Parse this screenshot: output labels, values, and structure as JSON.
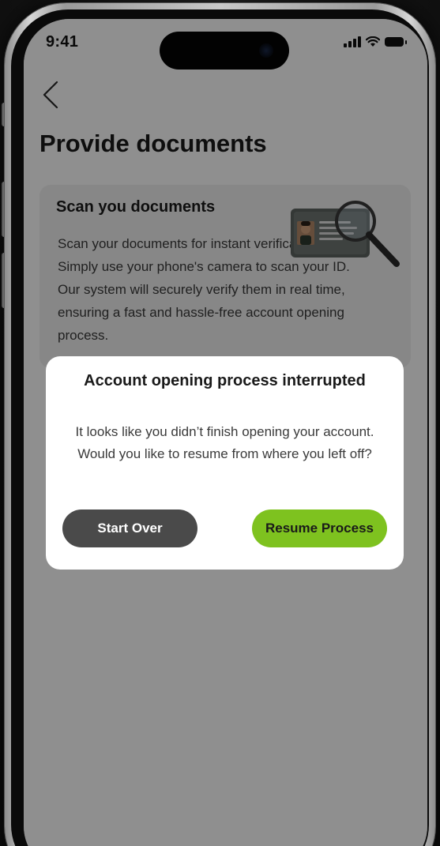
{
  "status_bar": {
    "time": "9:41"
  },
  "page": {
    "title": "Provide documents"
  },
  "doc_card": {
    "title": "Scan you documents",
    "body": "Scan your documents for instant verification. Simply use your phone's camera to scan your ID. Our system will securely verify them in real time, ensuring a fast and hassle-free account opening process."
  },
  "modal": {
    "title": "Account opening process interrupted",
    "message": "It looks like you didn’t finish opening your account. Would you like to resume from where you left off?",
    "start_over_label": "Start Over",
    "resume_label": "Resume Process"
  },
  "colors": {
    "resume_button": "#7ec21f",
    "start_button": "#4a4a4a",
    "overlay": "rgba(0,0,0,0.44)"
  },
  "icons": {
    "back": "chevron-left-icon",
    "signal": "cellular-signal-icon",
    "wifi": "wifi-icon",
    "battery": "battery-icon"
  }
}
